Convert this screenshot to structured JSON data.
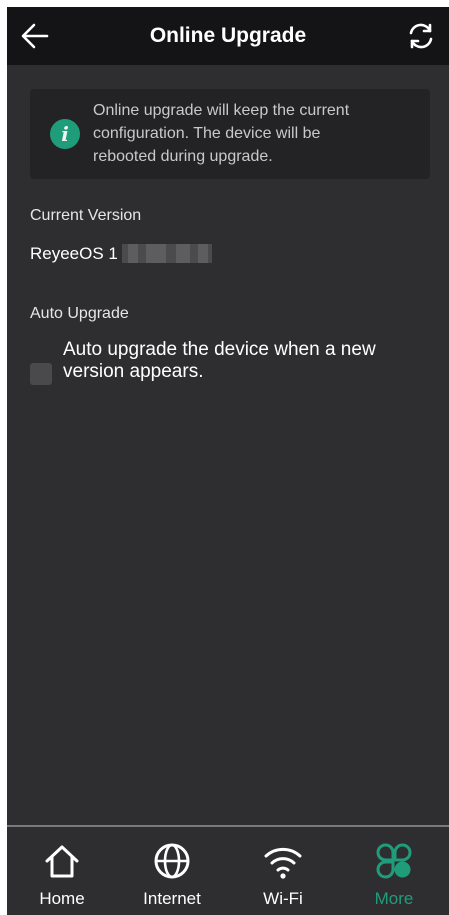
{
  "header": {
    "title": "Online Upgrade",
    "back_icon": "arrow-left-icon",
    "refresh_icon": "refresh-icon"
  },
  "info": {
    "icon": "info-icon",
    "lines": [
      "Online upgrade will keep the current",
      "configuration. The device will be",
      "rebooted during upgrade."
    ]
  },
  "current_version": {
    "label": "Current Version",
    "value": "ReyeeOS 1"
  },
  "auto_upgrade": {
    "label": "Auto Upgrade",
    "checkbox_label_lines": [
      "Auto upgrade the device when a new",
      "version appears."
    ],
    "checked": false
  },
  "nav": {
    "items": [
      {
        "label": "Home",
        "icon": "home-icon",
        "active": false
      },
      {
        "label": "Internet",
        "icon": "globe-icon",
        "active": false
      },
      {
        "label": "Wi-Fi",
        "icon": "wifi-icon",
        "active": false
      },
      {
        "label": "More",
        "icon": "more-icon",
        "active": true
      }
    ]
  },
  "colors": {
    "accent": "#1f9d7b",
    "header_bg": "#141416",
    "page_bg": "#2e2e30",
    "info_bg": "#232325"
  }
}
